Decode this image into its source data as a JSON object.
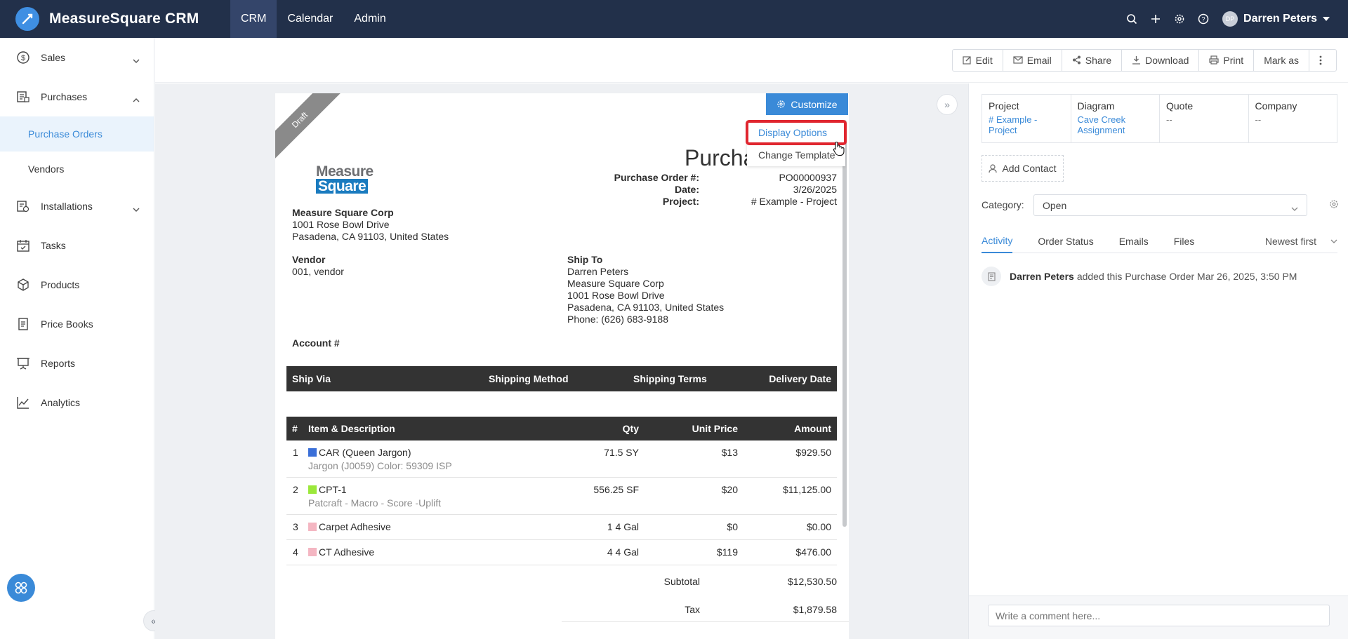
{
  "app": {
    "name": "MeasureSquare CRM"
  },
  "nav": {
    "tabs": [
      {
        "label": "CRM",
        "active": true
      },
      {
        "label": "Calendar",
        "active": false
      },
      {
        "label": "Admin",
        "active": false
      }
    ],
    "user": {
      "initials": "DP",
      "name": "Darren Peters"
    },
    "icons": [
      "search-icon",
      "plus-icon",
      "gear-icon",
      "help-icon"
    ]
  },
  "sidebar": {
    "items": [
      {
        "label": "Sales",
        "icon": "dollar-icon",
        "expandable": true,
        "expanded": false
      },
      {
        "label": "Purchases",
        "icon": "purchases-icon",
        "expandable": true,
        "expanded": true
      },
      {
        "label": "Installations",
        "icon": "installations-icon",
        "expandable": true,
        "expanded": false
      },
      {
        "label": "Tasks",
        "icon": "calendar-check-icon"
      },
      {
        "label": "Products",
        "icon": "box-icon"
      },
      {
        "label": "Price Books",
        "icon": "document-icon"
      },
      {
        "label": "Reports",
        "icon": "presentation-icon"
      },
      {
        "label": "Analytics",
        "icon": "line-chart-icon"
      }
    ],
    "purchases_sub": [
      {
        "label": "Purchase Orders",
        "active": true
      },
      {
        "label": "Vendors",
        "active": false
      }
    ]
  },
  "toolbar": {
    "buttons": [
      {
        "label": "Edit",
        "icon": "edit-icon"
      },
      {
        "label": "Email",
        "icon": "mail-icon"
      },
      {
        "label": "Share",
        "icon": "share-icon"
      },
      {
        "label": "Download",
        "icon": "download-icon"
      },
      {
        "label": "Print",
        "icon": "print-icon"
      },
      {
        "label": "Mark as",
        "icon": ""
      }
    ]
  },
  "document": {
    "ribbon": "Draft",
    "customize_label": "Customize",
    "menu": [
      {
        "label": "Display Options",
        "highlighted": true
      },
      {
        "label": "Change Template",
        "highlighted": false
      }
    ],
    "logo": {
      "line1": "Measure",
      "line2": "Square"
    },
    "title": "Purcha",
    "meta": [
      {
        "key": "Purchase Order #:",
        "value": "PO00000937"
      },
      {
        "key": "Date:",
        "value": "3/26/2025"
      },
      {
        "key": "Project:",
        "value": "# Example - Project"
      }
    ],
    "company": {
      "name": "Measure Square Corp",
      "line1": "1001 Rose Bowl Drive",
      "line2": "Pasadena, CA 91103, United States"
    },
    "vendor": {
      "heading": "Vendor",
      "value": "001, vendor"
    },
    "ship_to": {
      "heading": "Ship To",
      "lines": [
        "Darren Peters",
        "Measure Square Corp",
        "1001 Rose Bowl Drive",
        "Pasadena, CA 91103, United States",
        "Phone: (626) 683-9188"
      ]
    },
    "account_label": "Account #",
    "ship_bar": [
      "Ship Via",
      "Shipping Method",
      "Shipping Terms",
      "Delivery Date"
    ],
    "items_header": {
      "num": "#",
      "desc": "Item & Description",
      "qty": "Qty",
      "unit": "Unit Price",
      "amount": "Amount"
    },
    "items": [
      {
        "num": "1",
        "color": "#3a6fd8",
        "name": "CAR (Queen Jargon)",
        "sub": "Jargon (J0059) Color: 59309 ISP",
        "qty": "71.5 SY",
        "unit": "$13",
        "amount": "$929.50"
      },
      {
        "num": "2",
        "color": "#9be83a",
        "name": "CPT-1",
        "sub": "Patcraft - Macro - Score -Uplift",
        "qty": "556.25 SF",
        "unit": "$20",
        "amount": "$11,125.00"
      },
      {
        "num": "3",
        "color": "#f4b6c2",
        "name": "Carpet Adhesive",
        "sub": "",
        "qty": "1 4 Gal",
        "unit": "$0",
        "amount": "$0.00"
      },
      {
        "num": "4",
        "color": "#f4b6c2",
        "name": "CT Adhesive",
        "sub": "",
        "qty": "4 4 Gal",
        "unit": "$119",
        "amount": "$476.00"
      }
    ],
    "totals": [
      {
        "label": "Subtotal",
        "value": "$12,530.50"
      },
      {
        "label": "Tax",
        "value": "$1,879.58"
      }
    ]
  },
  "right_panel": {
    "info": [
      {
        "label": "Project",
        "value": "# Example - Project",
        "link": true
      },
      {
        "label": "Diagram",
        "value": "Cave Creek Assignment",
        "link": true
      },
      {
        "label": "Quote",
        "value": "--",
        "link": false
      },
      {
        "label": "Company",
        "value": "--",
        "link": false
      }
    ],
    "add_contact": "Add Contact",
    "category_label": "Category:",
    "category_value": "Open",
    "tabs": [
      {
        "label": "Activity",
        "active": true
      },
      {
        "label": "Order Status",
        "active": false
      },
      {
        "label": "Emails",
        "active": false
      },
      {
        "label": "Files",
        "active": false
      }
    ],
    "sort": "Newest first",
    "activity": {
      "who": "Darren Peters",
      "text": "added this Purchase Order Mar 26, 2025, 3:50 PM"
    },
    "comment_placeholder": "Write a comment here..."
  }
}
